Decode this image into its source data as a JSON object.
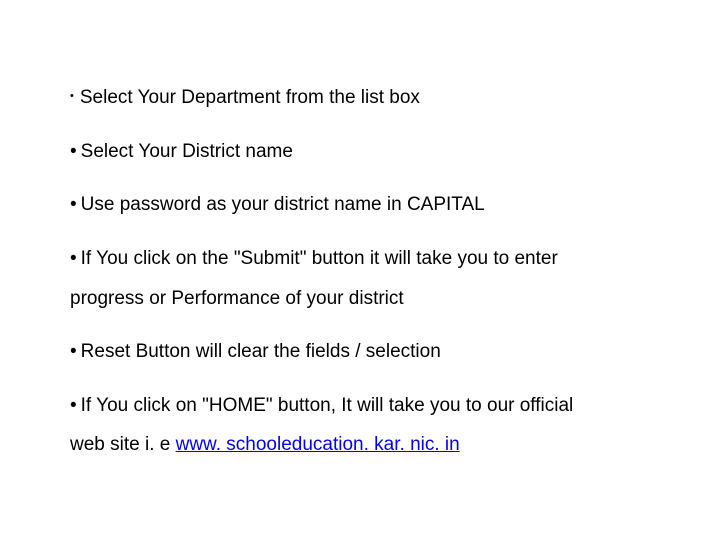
{
  "bullets": {
    "b1": "Select Your Department from the list box",
    "b2": "Select Your District name",
    "b3": "Use password as your district name in CAPITAL",
    "b4a": "If  You click on the \"Submit\" button it will take you to enter",
    "b4b": "progress or Performance of your district",
    "b5": "Reset Button will clear the fields / selection",
    "b6a": "If You click on \"HOME\" button, It will take you to our official",
    "b6b_prefix": "web site i. e ",
    "b6b_link": "www. schooleducation. kar. nic. in"
  }
}
